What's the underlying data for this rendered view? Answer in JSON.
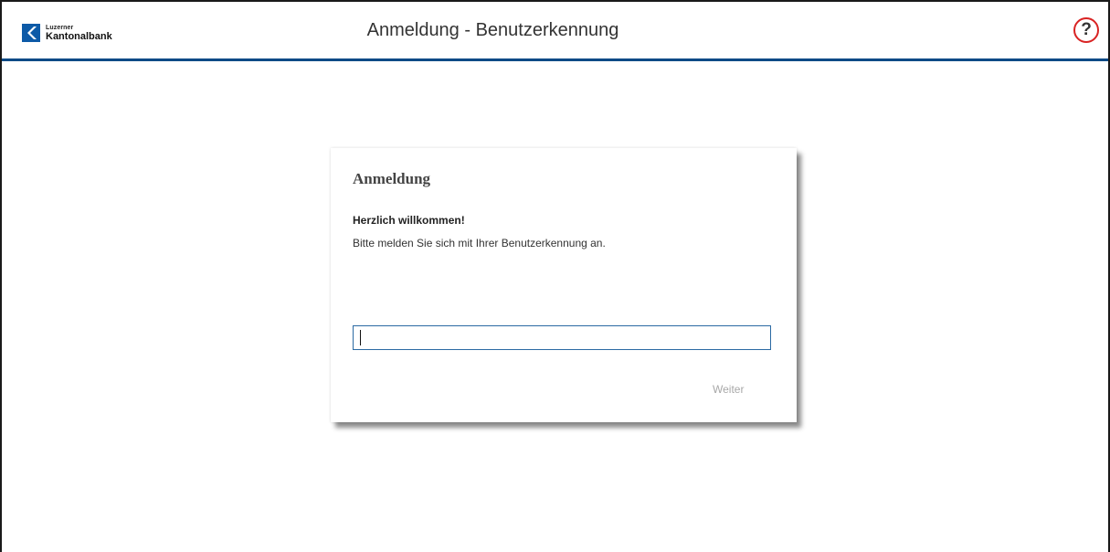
{
  "header": {
    "logo": {
      "line1": "Luzerner",
      "line2": "Kantonalbank",
      "brand_color": "#0d5aa7"
    },
    "title": "Anmeldung - Benutzerkennung",
    "help": {
      "icon": "question-mark-icon",
      "label": "?",
      "ring_color": "#d92323"
    },
    "accent_color": "#0b4a86"
  },
  "login_card": {
    "title": "Anmeldung",
    "welcome": "Herzlich willkommen!",
    "description": "Bitte melden Sie sich mit Ihrer Benutzerkennung an.",
    "username_input": {
      "value": "",
      "placeholder": ""
    },
    "next_label": "Weiter"
  }
}
